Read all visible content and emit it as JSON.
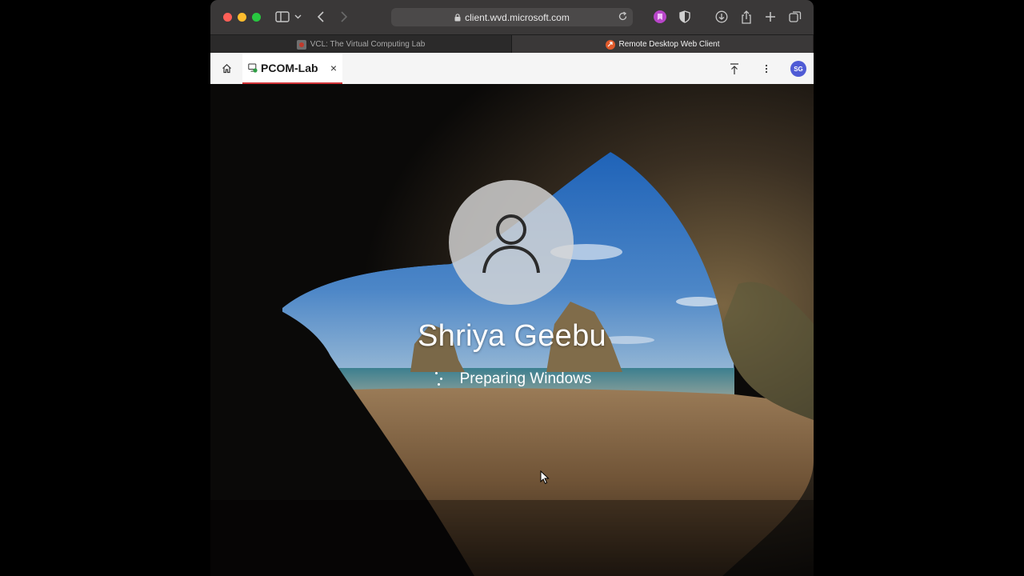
{
  "browser": {
    "url": "client.wvd.microsoft.com",
    "tabs": [
      {
        "label": "VCL: The Virtual Computing Lab",
        "active": false
      },
      {
        "label": "Remote Desktop Web Client",
        "active": true
      }
    ]
  },
  "rd_client": {
    "session_tab": {
      "label": "PCOM-Lab",
      "close_symbol": "×"
    },
    "user_initials": "SG"
  },
  "lock_screen": {
    "user_name": "Shriya Geebu",
    "status_text": "Preparing Windows"
  },
  "colors": {
    "tab_accent": "#d13438",
    "avatar_bg": "#4f5bd5",
    "toolbar_bg": "#3a3838"
  }
}
